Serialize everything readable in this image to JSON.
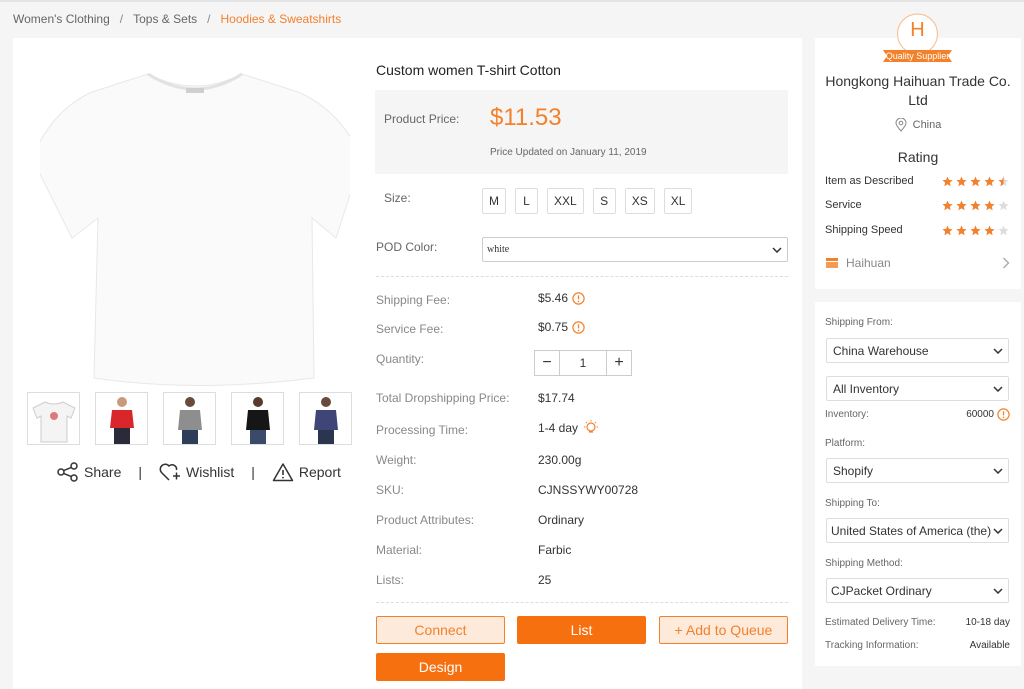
{
  "breadcrumb": [
    "Women's Clothing",
    "Tops & Sets",
    "Hoodies & Sweatshirts"
  ],
  "product": {
    "title": "Custom women T-shirt Cotton",
    "price_label": "Product Price:",
    "price": "$11.53",
    "price_updated": "Price Updated on January 11, 2019",
    "size_label": "Size:",
    "sizes": [
      "M",
      "L",
      "XXL",
      "S",
      "XS",
      "XL"
    ],
    "color_label": "POD Color:",
    "color_value": "white",
    "shipping_fee_label": "Shipping Fee:",
    "shipping_fee": "$5.46",
    "service_fee_label": "Service Fee:",
    "service_fee": "$0.75",
    "quantity_label": "Quantity:",
    "quantity": "1",
    "total_label": "Total Dropshipping Price:",
    "total": "$17.74",
    "processing_label": "Processing Time:",
    "processing": "1-4 day",
    "weight_label": "Weight:",
    "weight": "230.00g",
    "sku_label": "SKU:",
    "sku": "CJNSSYWY00728",
    "attributes_label": "Product Attributes:",
    "attributes": "Ordinary",
    "material_label": "Material:",
    "material": "Farbic",
    "lists_label": "Lists:",
    "lists": "25"
  },
  "gallery": {
    "thumb_colors": [
      "#ffffff",
      "#d9262b",
      "#8e8e8e",
      "#161616",
      "#3f4677"
    ],
    "actions": {
      "share": "Share",
      "wishlist": "Wishlist",
      "report": "Report"
    }
  },
  "buttons": {
    "connect": "Connect",
    "list": "List",
    "add_queue": "+ Add to Queue",
    "design": "Design"
  },
  "supplier": {
    "badge_letter": "H",
    "badge_text": "Quality Supplier",
    "name": "Hongkong Haihuan Trade Co. Ltd",
    "location": "China",
    "rating_title": "Rating",
    "ratings": [
      {
        "label": "Item as Described",
        "stars": 4.5
      },
      {
        "label": "Service",
        "stars": 4
      },
      {
        "label": "Shipping Speed",
        "stars": 4
      }
    ],
    "store": "Haihuan"
  },
  "shipping": {
    "from_label": "Shipping From:",
    "from": "China Warehouse",
    "inventory_select": "All Inventory",
    "inventory_label": "Inventory:",
    "inventory": "60000",
    "platform_label": "Platform:",
    "platform": "Shopify",
    "to_label": "Shipping To:",
    "to": "United States of America (the)",
    "method_label": "Shipping Method:",
    "method": "CJPacket Ordinary",
    "delivery_label": "Estimated Delivery Time:",
    "delivery": "10-18 day",
    "tracking_label": "Tracking Information:",
    "tracking": "Available"
  },
  "colors": {
    "accent": "#f3812c",
    "star": "#f3812c",
    "star_empty": "#dddddd"
  }
}
